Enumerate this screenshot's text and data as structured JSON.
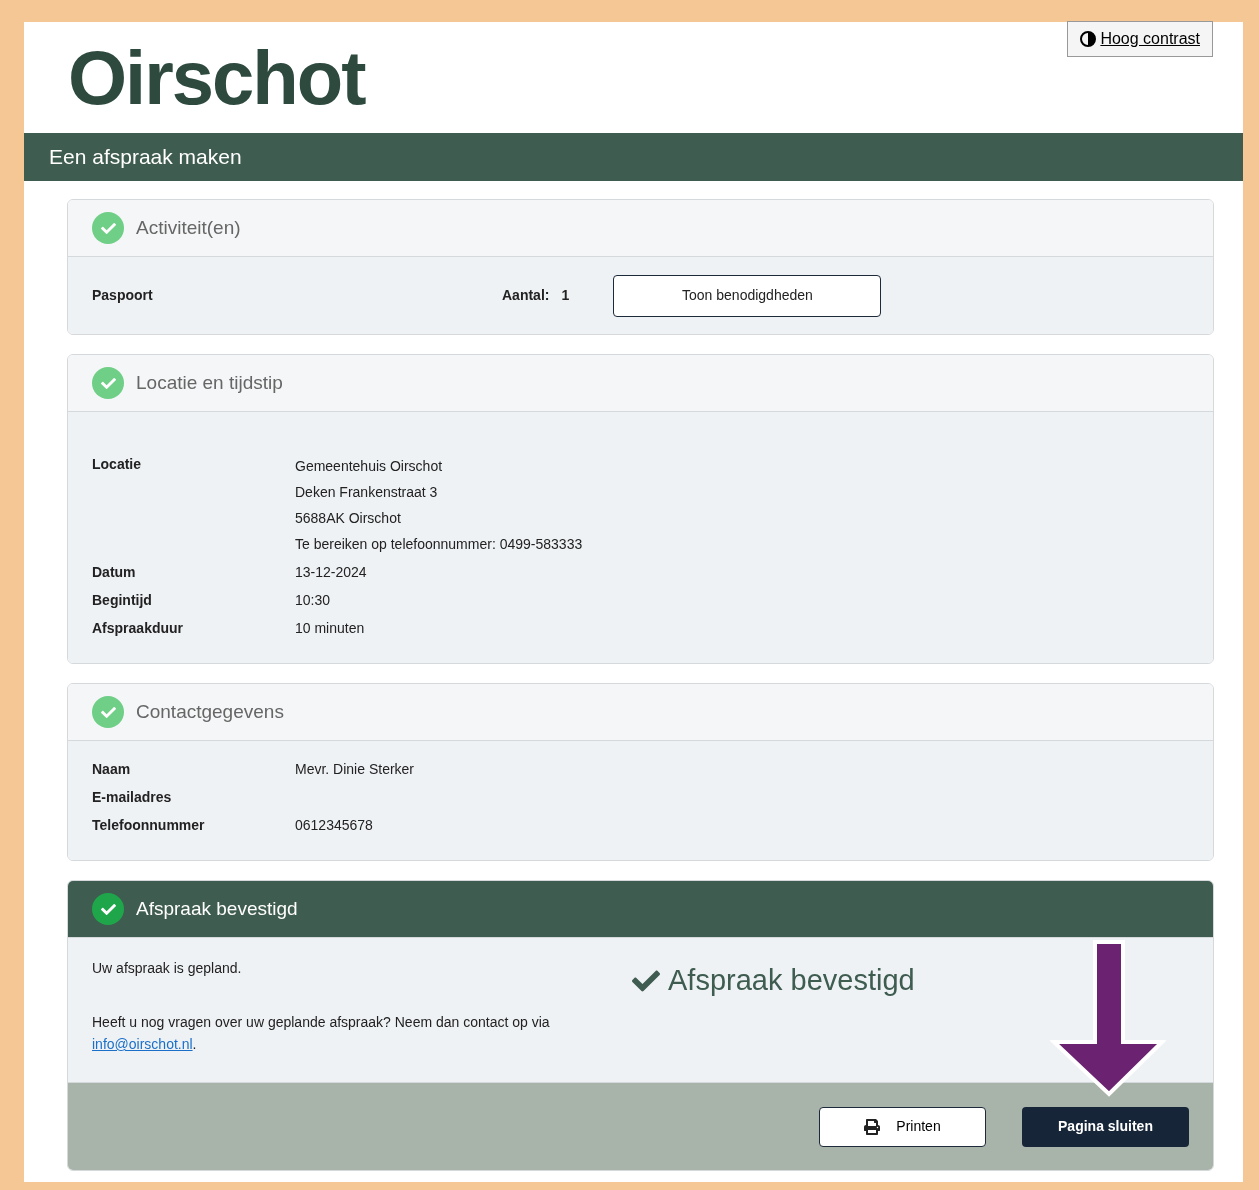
{
  "header": {
    "logo": "Oirschot",
    "contrast_link": "Hoog contrast"
  },
  "title_bar": "Een afspraak maken",
  "sections": [
    {
      "kind": "activity",
      "title": "Activiteit(en)",
      "completed": true,
      "item": "Paspoort",
      "count_label": "Aantal:",
      "count": "1",
      "button": "Toon benodigdheden"
    },
    {
      "kind": "details",
      "title": "Locatie en tijdstip",
      "completed": true,
      "rows": [
        {
          "label": "Locatie",
          "lines": [
            "Gemeentehuis Oirschot",
            "Deken Frankenstraat 3",
            "5688AK Oirschot",
            "Te bereiken op telefoonnummer: 0499-583333"
          ]
        },
        {
          "label": "Datum",
          "lines": [
            "13-12-2024"
          ]
        },
        {
          "label": "Begintijd",
          "lines": [
            "10:30"
          ]
        },
        {
          "label": "Afspraakduur",
          "lines": [
            "10 minuten"
          ]
        }
      ]
    },
    {
      "kind": "details",
      "title": "Contactgegevens",
      "completed": true,
      "rows": [
        {
          "label": "Naam",
          "lines": [
            "Mevr. Dinie Sterker"
          ]
        },
        {
          "label": "E-mailadres",
          "lines": []
        },
        {
          "label": "Telefoonnummer",
          "lines": [
            "0612345678"
          ]
        }
      ]
    },
    {
      "kind": "confirmation",
      "title": "Afspraak bevestigd",
      "completed": true,
      "message": "Uw afspraak is gepland.",
      "question": "Heeft u nog vragen over uw geplande afspraak? Neem dan contact op via",
      "email": "info@oirschot.nl",
      "after_email": ".",
      "status": "Afspraak bevestigd",
      "buttons": [
        {
          "label": "Printen",
          "kind": "secondary"
        },
        {
          "label": "Pagina sluiten",
          "kind": "primary"
        }
      ]
    }
  ]
}
